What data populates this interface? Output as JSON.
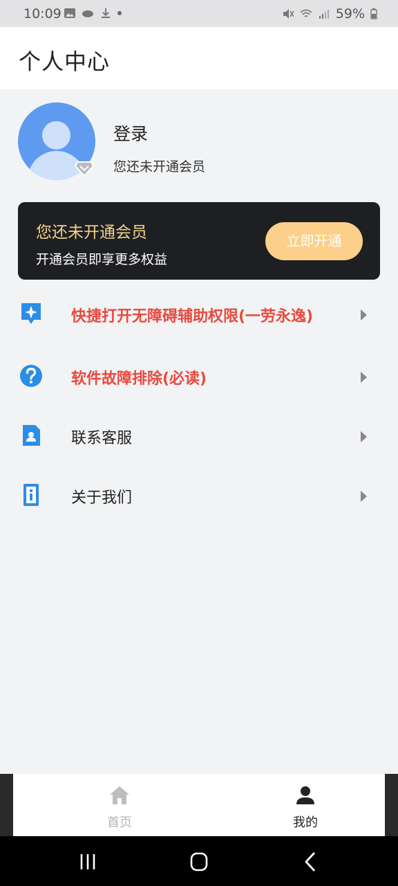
{
  "status_bar": {
    "time": "10:09",
    "battery": "59%"
  },
  "header": {
    "title": "个人中心"
  },
  "profile": {
    "login_label": "登录",
    "member_status": "您还未开通会员"
  },
  "vip_card": {
    "title": "您还未开通会员",
    "subtitle": "开通会员即享更多权益",
    "button_label": "立即开通",
    "colors": {
      "background": "#1e1f22",
      "title": "#f1d28c",
      "button": "#fcd08a"
    }
  },
  "menu": {
    "items": [
      {
        "label": "快捷打开无障碍辅助权限(一劳永逸)",
        "icon": "accessibility-star-icon"
      },
      {
        "label": "软件故障排除(必读)",
        "icon": "question-circle-icon"
      },
      {
        "label": "联系客服",
        "icon": "contact-card-icon"
      },
      {
        "label": "关于我们",
        "icon": "info-icon"
      }
    ],
    "highlight_color": "#e84a3f",
    "icon_color": "#2c8de6"
  },
  "bottom_nav": {
    "tabs": [
      {
        "label": "首页",
        "icon": "home-icon",
        "active": false
      },
      {
        "label": "我的",
        "icon": "user-icon",
        "active": true
      }
    ]
  }
}
